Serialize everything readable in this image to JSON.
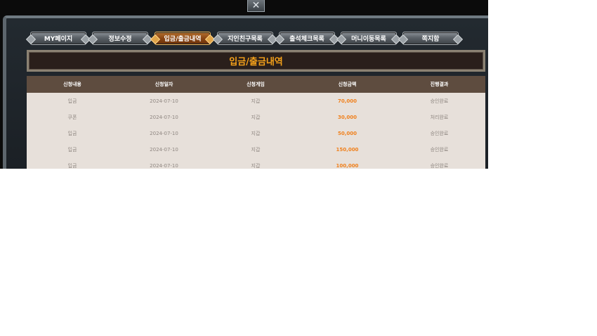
{
  "window": {
    "close_icon": "close-icon"
  },
  "tabs": [
    {
      "label": "MY페이지",
      "active": false
    },
    {
      "label": "정보수정",
      "active": false
    },
    {
      "label": "입금/출금내역",
      "active": true
    },
    {
      "label": "지인친구목록",
      "active": false
    },
    {
      "label": "출석체크목록",
      "active": false
    },
    {
      "label": "머니이동목록",
      "active": false
    },
    {
      "label": "쪽지함",
      "active": false
    }
  ],
  "page_title": "입금/출금내역",
  "table": {
    "headers": [
      "신청내용",
      "신청일자",
      "신청게임",
      "신청금액",
      "진행결과"
    ],
    "rows": [
      [
        "입금",
        "2024-07-10",
        "지갑",
        "70,000",
        "승인완료"
      ],
      [
        "쿠폰",
        "2024-07-10",
        "지갑",
        "30,000",
        "처리완료"
      ],
      [
        "입금",
        "2024-07-10",
        "지갑",
        "50,000",
        "승인완료"
      ],
      [
        "입금",
        "2024-07-10",
        "지갑",
        "150,000",
        "승인완료"
      ],
      [
        "입금",
        "2024-07-10",
        "지갑",
        "100,000",
        "승인완료"
      ]
    ]
  },
  "colors": {
    "accent": "#f6a21a",
    "amount": "#f0801c",
    "header_bg": "#5e4c3f",
    "row_bg": "#e7e0da"
  }
}
